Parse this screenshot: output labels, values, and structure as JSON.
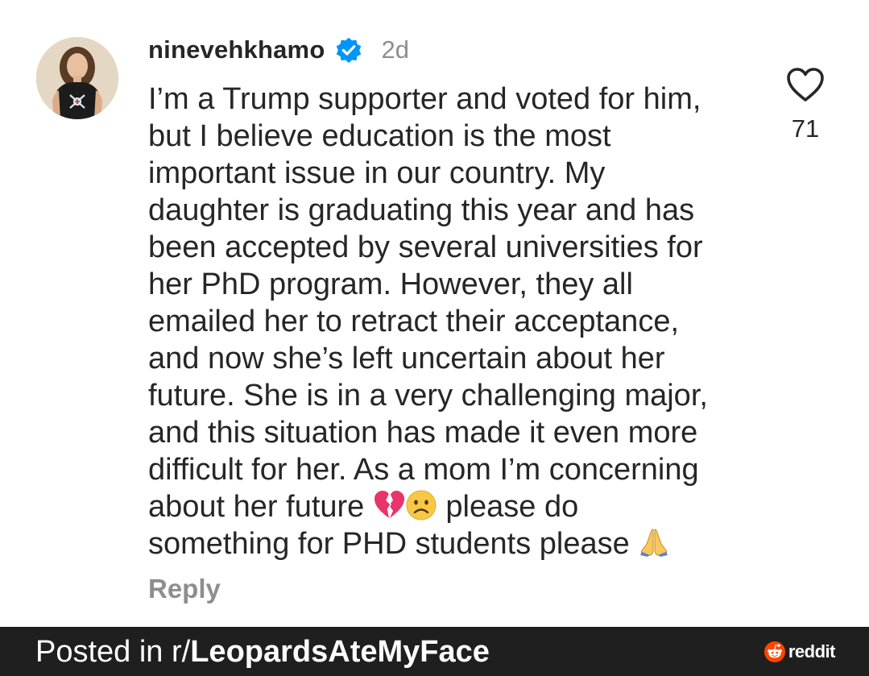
{
  "comment": {
    "username": "ninevehkhamo",
    "verified_icon": "verified-badge-icon",
    "timestamp": "2d",
    "lines": [
      "I’m a Trump supporter and voted for him,",
      "but I believe education is the most",
      "important issue in our country. My",
      "daughter is graduating this year and has",
      "been accepted by several universities for",
      "her PhD program. However, they all",
      "emailed her to retract their acceptance,",
      "and now she’s left uncertain about her",
      "future. She is in a very challenging major,",
      "and this situation has made it even more",
      "difficult for her. As a mom I’m concerning"
    ],
    "line_12_before": "about her future ",
    "line_12_after": " please do",
    "line_13": "something for PHD students please ",
    "emojis": [
      "broken-heart",
      "sad-face",
      "folded-hands"
    ],
    "reply_label": "Reply",
    "like_count": "71",
    "like_icon": "heart-outline-icon"
  },
  "footer": {
    "posted_prefix": "Posted in r/",
    "subreddit": "LeopardsAteMyFace",
    "brand": "reddit"
  },
  "colors": {
    "text_primary": "#262626",
    "text_secondary": "#8e8e8e",
    "verified_blue": "#0095f6",
    "footer_bg": "#1f1f1f",
    "reddit_orange": "#ff4500"
  }
}
